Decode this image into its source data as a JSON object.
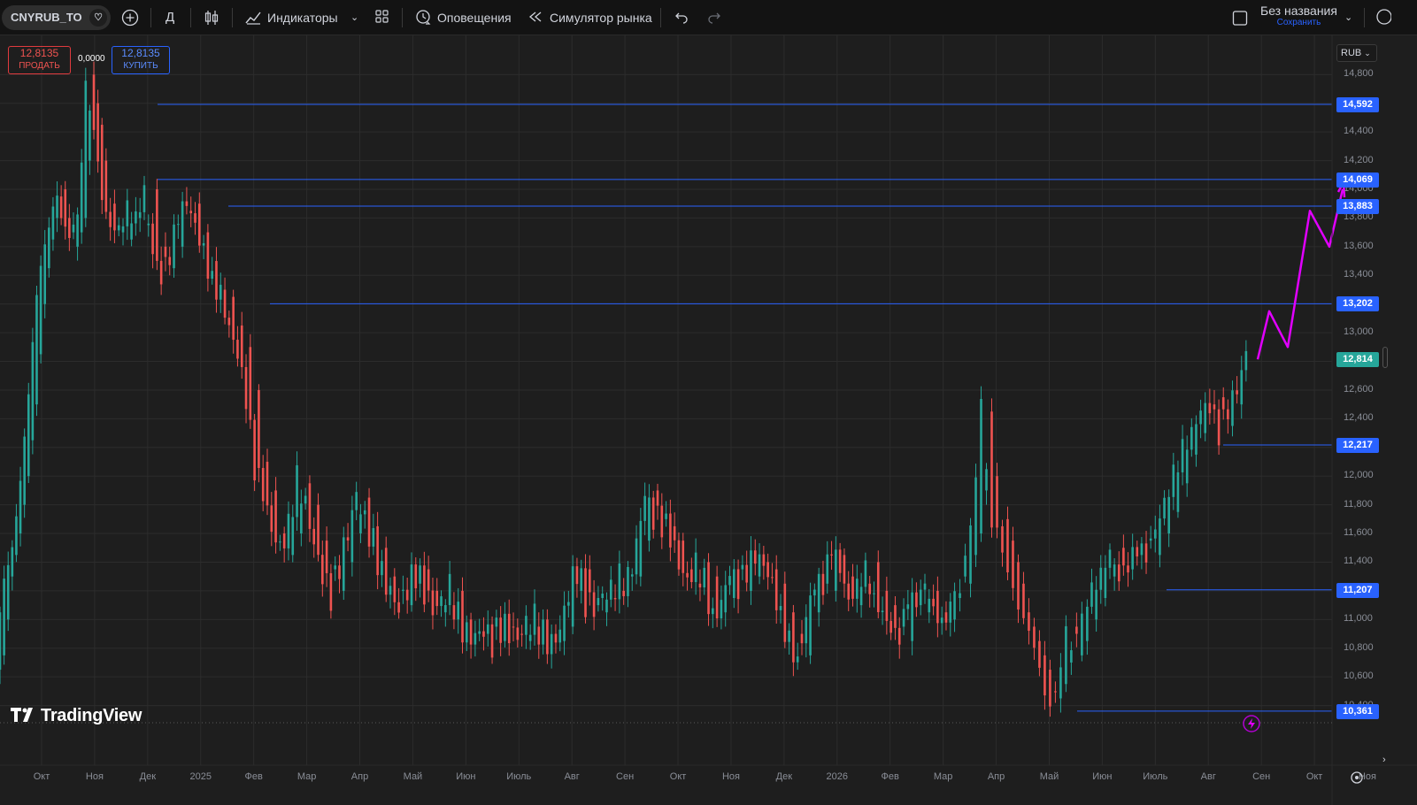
{
  "toolbar": {
    "symbol": "CNYRUB_TO",
    "interval": "Д",
    "indicators": "Индикаторы",
    "alerts": "Оповещения",
    "replay": "Симулятор рынка",
    "layout_name": "Без названия",
    "save": "Сохранить"
  },
  "order": {
    "sell_price": "12,8135",
    "sell_label": "ПРОДАТЬ",
    "spread": "0,0000",
    "buy_price": "12,8135",
    "buy_label": "КУПИТЬ"
  },
  "currency": "RUB",
  "brand": "TradingView",
  "colors": {
    "up": "#26a69a",
    "down": "#ef5350",
    "level_line": "#2962ff",
    "drawing": "#e100ff",
    "last_price": "#26a69a"
  },
  "chart_data": {
    "type": "candlestick",
    "symbol": "CNYRUB_TO",
    "ylim": [
      10.2,
      14.95
    ],
    "y_ticks": [
      "14,800",
      "14,600",
      "14,400",
      "14,200",
      "14,000",
      "13,800",
      "13,600",
      "13,400",
      "13,200",
      "13,000",
      "12,800",
      "12,600",
      "12,400",
      "12,200",
      "12,000",
      "11,800",
      "11,600",
      "11,400",
      "11,200",
      "11,000",
      "10,800",
      "10,600",
      "10,400"
    ],
    "x_ticks": [
      "Окт",
      "Ноя",
      "Дек",
      "2025",
      "Фев",
      "Мар",
      "Апр",
      "Май",
      "Июн",
      "Июль",
      "Авг",
      "Сен",
      "Окт",
      "Ноя",
      "Дек",
      "2026",
      "Фев",
      "Мар",
      "Апр",
      "Май",
      "Июн",
      "Июль",
      "Авг",
      "Сен",
      "Окт",
      "Ноя"
    ],
    "last_price": 12.814,
    "levels": [
      {
        "price": 14.592,
        "label": "14,592",
        "from": "Дек"
      },
      {
        "price": 14.069,
        "label": "14,069",
        "from": "Дек"
      },
      {
        "price": 13.883,
        "label": "13,883",
        "from": "2025"
      },
      {
        "price": 13.202,
        "label": "13,202",
        "from": "Фев"
      },
      {
        "price": 12.217,
        "label": "12,217",
        "from": "Авг"
      },
      {
        "price": 11.207,
        "label": "11,207",
        "from": "Июль"
      },
      {
        "price": 10.361,
        "label": "10,361",
        "from": "Июн"
      }
    ],
    "trend_path": [
      12.814,
      13.15,
      12.9,
      13.85,
      13.6,
      14.0
    ],
    "closes": [
      [
        10.75,
        11.0,
        11.3,
        11.45,
        11.6,
        11.8,
        12.0,
        12.25,
        12.5,
        12.85,
        13.2,
        13.45,
        13.65,
        13.8,
        13.95,
        14.0,
        13.8,
        13.7,
        13.6,
        13.7,
        13.8,
        14.2,
        14.8,
        14.6,
        14.45,
        14.2
      ],
      [
        13.9,
        13.7,
        13.65,
        13.8,
        13.75,
        14.0,
        13.6,
        13.45,
        13.6,
        13.85,
        13.9,
        13.7,
        13.5,
        13.3,
        13.25,
        13.05,
        12.9,
        12.6,
        12.1,
        11.9,
        11.6,
        11.45,
        11.6,
        11.95,
        11.8
      ],
      [
        11.55,
        11.35,
        11.2,
        11.4,
        11.6,
        11.85,
        11.65,
        11.5,
        11.3,
        11.2,
        11.1,
        11.25,
        11.35,
        11.2,
        11.05,
        11.1,
        11.2,
        11.0,
        10.9,
        10.9,
        10.95,
        10.85,
        10.95,
        10.9,
        10.85
      ],
      [
        10.95,
        11.0,
        10.9,
        10.85,
        10.95,
        11.2,
        11.35,
        11.1,
        11.05,
        11.15,
        11.2,
        11.3,
        11.3,
        11.55,
        11.9,
        11.7,
        11.65,
        11.55,
        11.35,
        11.25,
        11.4,
        11.3,
        11.05,
        11.15,
        11.35
      ],
      [
        11.2,
        11.3,
        11.4,
        11.35,
        11.25,
        11.05,
        10.9,
        10.75,
        11.05,
        11.25,
        11.2,
        11.45,
        11.3,
        11.1,
        11.25,
        11.4,
        11.2,
        11.1,
        10.95,
        10.85,
        11.1,
        11.05,
        11.2,
        11.05,
        11.0
      ],
      [
        11.15,
        11.3,
        11.25,
        11.45,
        11.6,
        11.9,
        12.45,
        12.0,
        11.65,
        11.7,
        11.55,
        11.4,
        11.25,
        11.05,
        10.95,
        10.85,
        10.75,
        10.65,
        10.5,
        10.45,
        10.55,
        10.7,
        10.95,
        10.75,
        10.85
      ],
      [
        11.0,
        11.15,
        11.3,
        11.5,
        11.35,
        11.45,
        11.55,
        11.45,
        11.6,
        11.75,
        11.95,
        12.15,
        12.3,
        12.5,
        12.55,
        12.35,
        12.5,
        12.6,
        12.814
      ]
    ]
  }
}
